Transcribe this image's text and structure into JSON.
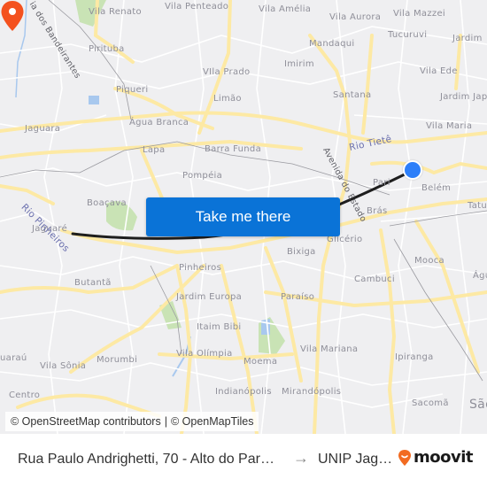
{
  "map": {
    "labels": [
      {
        "text": "Vila Renato",
        "kind": "place"
      },
      {
        "text": "Vila Penteado",
        "kind": "place"
      },
      {
        "text": "Vila Amélia",
        "kind": "place"
      },
      {
        "text": "Vila Aurora",
        "kind": "place"
      },
      {
        "text": "Vila Mazzei",
        "kind": "place"
      },
      {
        "text": "Tucuruvi",
        "kind": "place"
      },
      {
        "text": "Jardim",
        "kind": "place"
      },
      {
        "text": "Pirituba",
        "kind": "place"
      },
      {
        "text": "Mandaqui",
        "kind": "place"
      },
      {
        "text": "VIla Prado",
        "kind": "place"
      },
      {
        "text": "Imirim",
        "kind": "place"
      },
      {
        "text": "Vila Ede",
        "kind": "place"
      },
      {
        "text": "Piqueri",
        "kind": "place"
      },
      {
        "text": "Limão",
        "kind": "place"
      },
      {
        "text": "Santana",
        "kind": "place"
      },
      {
        "text": "Jardim Jap",
        "kind": "place"
      },
      {
        "text": "Jaguara",
        "kind": "place"
      },
      {
        "text": "Água Branca",
        "kind": "place"
      },
      {
        "text": "Vila Maria",
        "kind": "place"
      },
      {
        "text": "Lapa",
        "kind": "place"
      },
      {
        "text": "Barra Funda",
        "kind": "place"
      },
      {
        "text": "Pompéia",
        "kind": "place"
      },
      {
        "text": "Pari",
        "kind": "place"
      },
      {
        "text": "Belém",
        "kind": "place"
      },
      {
        "text": "Boaçava",
        "kind": "place"
      },
      {
        "text": "Brás",
        "kind": "place"
      },
      {
        "text": "Tatu",
        "kind": "place"
      },
      {
        "text": "Jaguaré",
        "kind": "place"
      },
      {
        "text": "Glicério",
        "kind": "place"
      },
      {
        "text": "Bixiga",
        "kind": "place"
      },
      {
        "text": "Mooca",
        "kind": "place"
      },
      {
        "text": "Pinheiros",
        "kind": "place"
      },
      {
        "text": "Cambuci",
        "kind": "place"
      },
      {
        "text": "Butantã",
        "kind": "place"
      },
      {
        "text": "Jardim Europa",
        "kind": "place"
      },
      {
        "text": "Paraíso",
        "kind": "place"
      },
      {
        "text": "Água",
        "kind": "place"
      },
      {
        "text": "Itaim Bibi",
        "kind": "place"
      },
      {
        "text": "Vila Mariana",
        "kind": "place"
      },
      {
        "text": "uaraú",
        "kind": "place"
      },
      {
        "text": "Vila Sônia",
        "kind": "place"
      },
      {
        "text": "Morumbi",
        "kind": "place"
      },
      {
        "text": "Vila Olímpia",
        "kind": "place"
      },
      {
        "text": "Moema",
        "kind": "place"
      },
      {
        "text": "Ipiranga",
        "kind": "place"
      },
      {
        "text": "Centro",
        "kind": "place"
      },
      {
        "text": "Indianópolis",
        "kind": "place"
      },
      {
        "text": "Mirandópolis",
        "kind": "place"
      },
      {
        "text": "Sacomã",
        "kind": "place"
      },
      {
        "text": "São",
        "kind": "place"
      },
      {
        "text": "Rio Tietê",
        "kind": "river"
      },
      {
        "text": "Rio Pinheiros",
        "kind": "river"
      },
      {
        "text": "Avenida do Estado",
        "kind": "road"
      },
      {
        "text": "ia dos Bandeirantes",
        "kind": "road"
      }
    ],
    "colors": {
      "background": "#efeff1",
      "major_road": "#fde9a4",
      "minor_road": "#ffffff",
      "park": "#c9e3b5",
      "water": "#a8c8ee",
      "route": "#1e1e1e",
      "origin_pin": "#2d7ff9",
      "destination_pin": "#f4511e"
    }
  },
  "cta": {
    "label": "Take me there",
    "color": "#0a73d7"
  },
  "attribution": {
    "osm": "© OpenStreetMap contributors",
    "separator": "|",
    "omt": "© OpenMapTiles"
  },
  "footer": {
    "origin": "Rua Paulo Andrighetti, 70 - Alto do Par…",
    "arrow": "→",
    "destination": "UNIP Jag…",
    "brand": "moovit",
    "brand_color": "#f26b21"
  }
}
